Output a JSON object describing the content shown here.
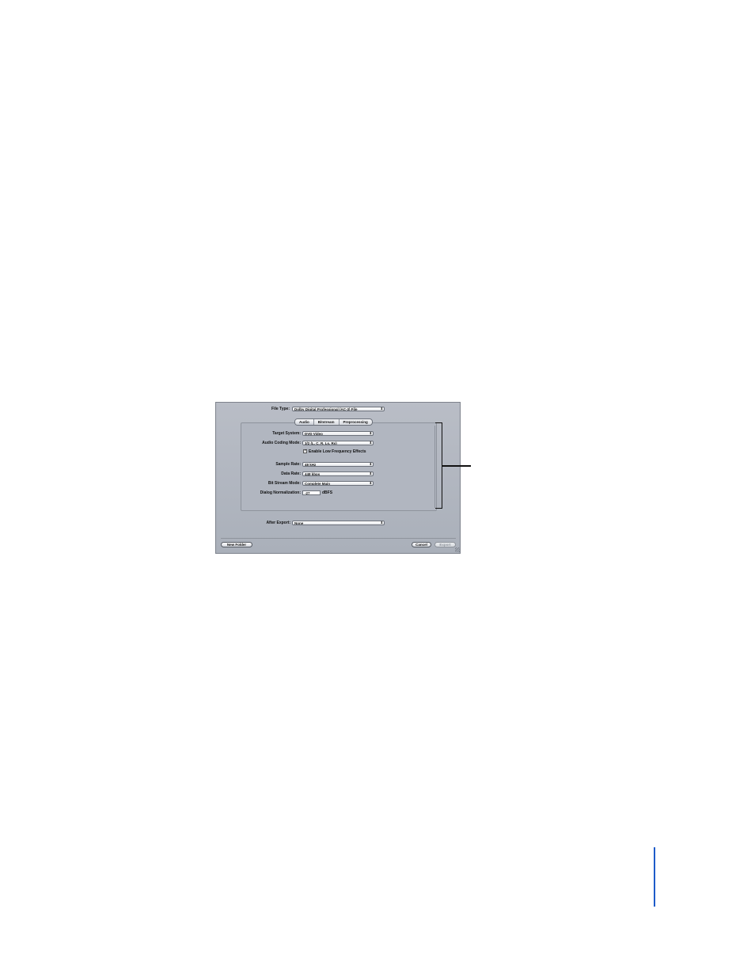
{
  "dialog": {
    "file_type": {
      "label": "File Type:",
      "value": "Dolby Digital Professional (AC-3) File"
    },
    "tabs": [
      {
        "label": "Audio",
        "active": true
      },
      {
        "label": "Bitstream",
        "active": false
      },
      {
        "label": "Preprocessing",
        "active": false
      }
    ],
    "fields": {
      "target_system": {
        "label": "Target System:",
        "value": "DVD Video"
      },
      "audio_coding_mode": {
        "label": "Audio Coding Mode:",
        "value": "3/2 (L, C, R, Ls, Rs)"
      },
      "lfe_checkbox": {
        "label": "Enable Low Frequency Effects",
        "checked": true,
        "mark": "✓"
      },
      "sample_rate": {
        "label": "Sample Rate:",
        "value": "48 kHz"
      },
      "data_rate": {
        "label": "Data Rate:",
        "value": "448 kbps"
      },
      "bit_stream_mode": {
        "label": "Bit Stream Mode:",
        "value": "Complete Main"
      },
      "dialog_normalization": {
        "label": "Dialog Normalization:",
        "value": "-27",
        "unit": "dBFS"
      }
    },
    "after_export": {
      "label": "After Export:",
      "value": "None"
    },
    "buttons": {
      "new_folder": "New Folder",
      "cancel": "Cancel",
      "export": "Export"
    },
    "popup_arrows": "⬍"
  },
  "colors": {
    "dialog_bg": "#b1b6c0",
    "margin_rule": "#1d5bc9"
  }
}
